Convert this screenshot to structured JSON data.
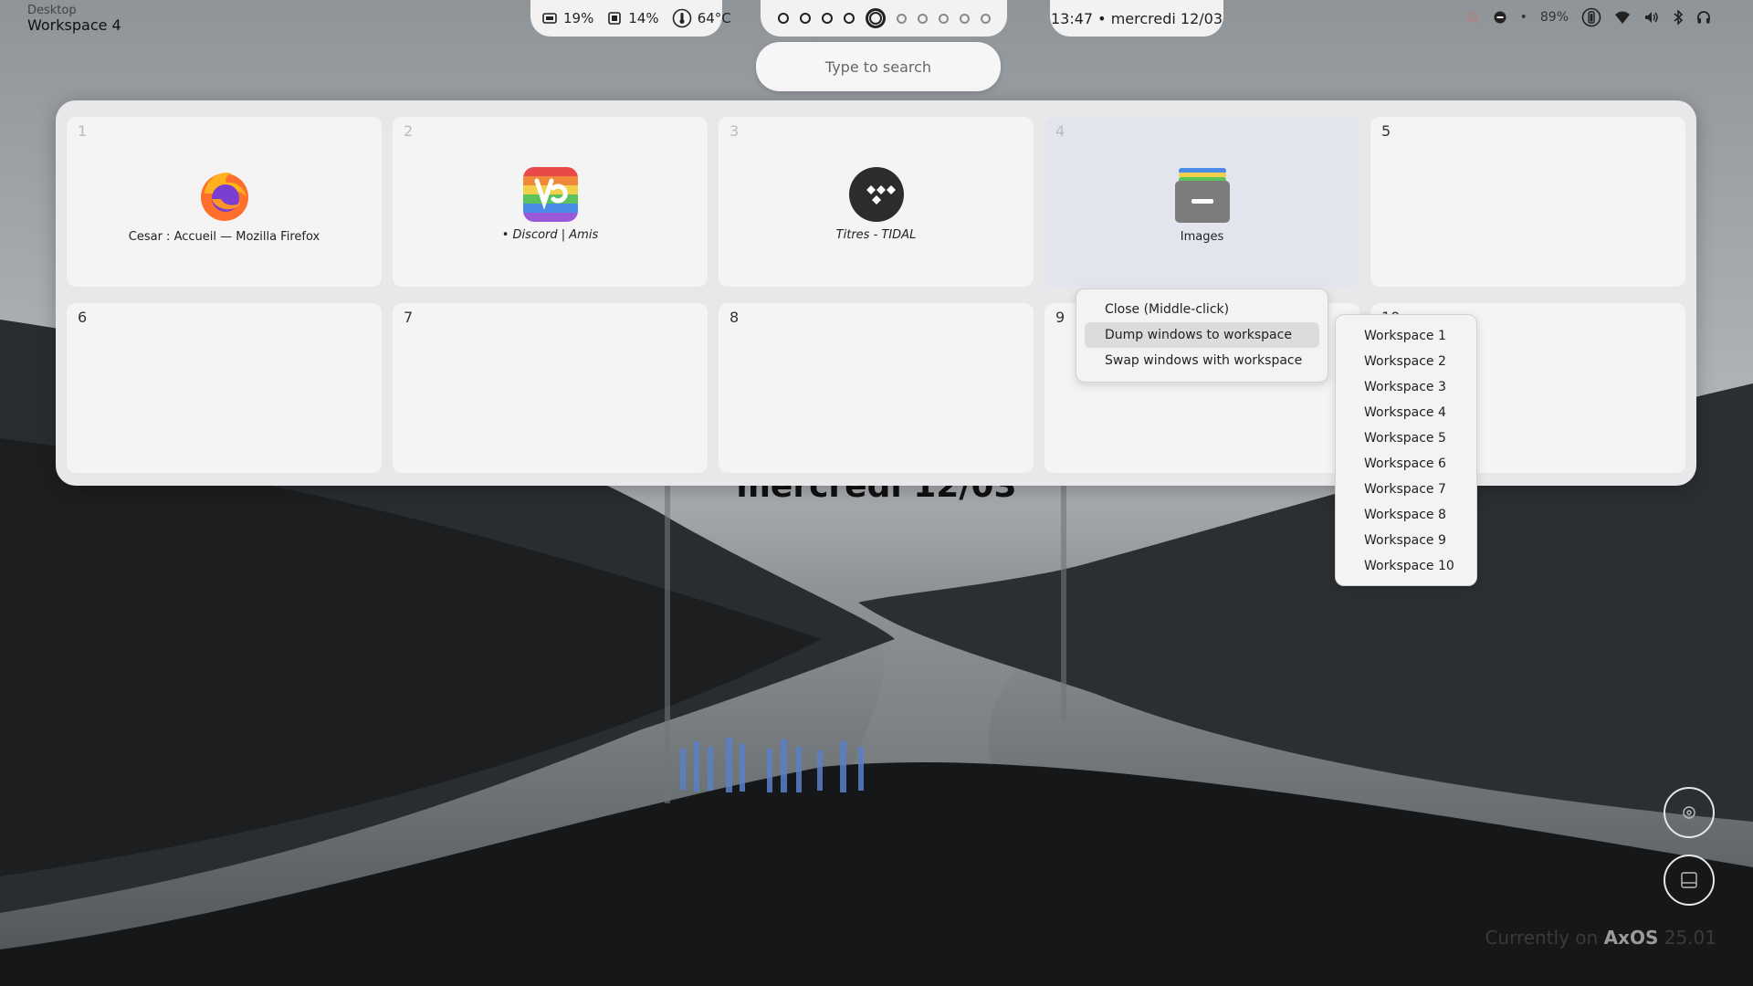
{
  "topbar": {
    "workspace_caption": "Desktop",
    "workspace_name": "Workspace 4",
    "resources": [
      {
        "icon": "ram-chip-icon",
        "value": "19%"
      },
      {
        "icon": "cpu-chip-icon",
        "value": "14%"
      },
      {
        "icon": "thermometer-icon",
        "value": "64°C"
      }
    ],
    "clock_text": "13:47 • mercredi 12/03",
    "battery_separator": "•",
    "battery_level": "89%"
  },
  "search": {
    "placeholder": "Type to search"
  },
  "overview": {
    "tiles": [
      {
        "number": "1",
        "window_title": "Cesar : Accueil — Mozilla Firefox",
        "app_icon": "firefox-icon"
      },
      {
        "number": "2",
        "window_title": "• Discord | Amis",
        "app_icon": "vesktop-icon"
      },
      {
        "number": "3",
        "window_title": "Titres - TIDAL",
        "app_icon": "tidal-icon"
      },
      {
        "number": "4",
        "window_title": "Images",
        "app_icon": "file-manager-icon"
      },
      {
        "number": "5"
      },
      {
        "number": "6"
      },
      {
        "number": "7"
      },
      {
        "number": "8"
      },
      {
        "number": "9"
      },
      {
        "number": "10"
      }
    ]
  },
  "context_menu": {
    "items": [
      "Close (Middle-click)",
      "Dump windows to workspace",
      "Swap windows with workspace"
    ],
    "highlighted_index": 1
  },
  "submenu": {
    "items": [
      "Workspace 1",
      "Workspace 2",
      "Workspace 3",
      "Workspace 4",
      "Workspace 5",
      "Workspace 6",
      "Workspace 7",
      "Workspace 8",
      "Workspace 9",
      "Workspace 10"
    ]
  },
  "desktop": {
    "date_text": "mercredi 12/03",
    "os_prefix": "Currently on",
    "os_name": "AxOS",
    "os_version": "25.01"
  },
  "colors": {
    "panel": "#e8e7e9",
    "tile": "#f5f4f5",
    "current_tile": "#e2e5ee",
    "accent_dark": "#222222"
  }
}
